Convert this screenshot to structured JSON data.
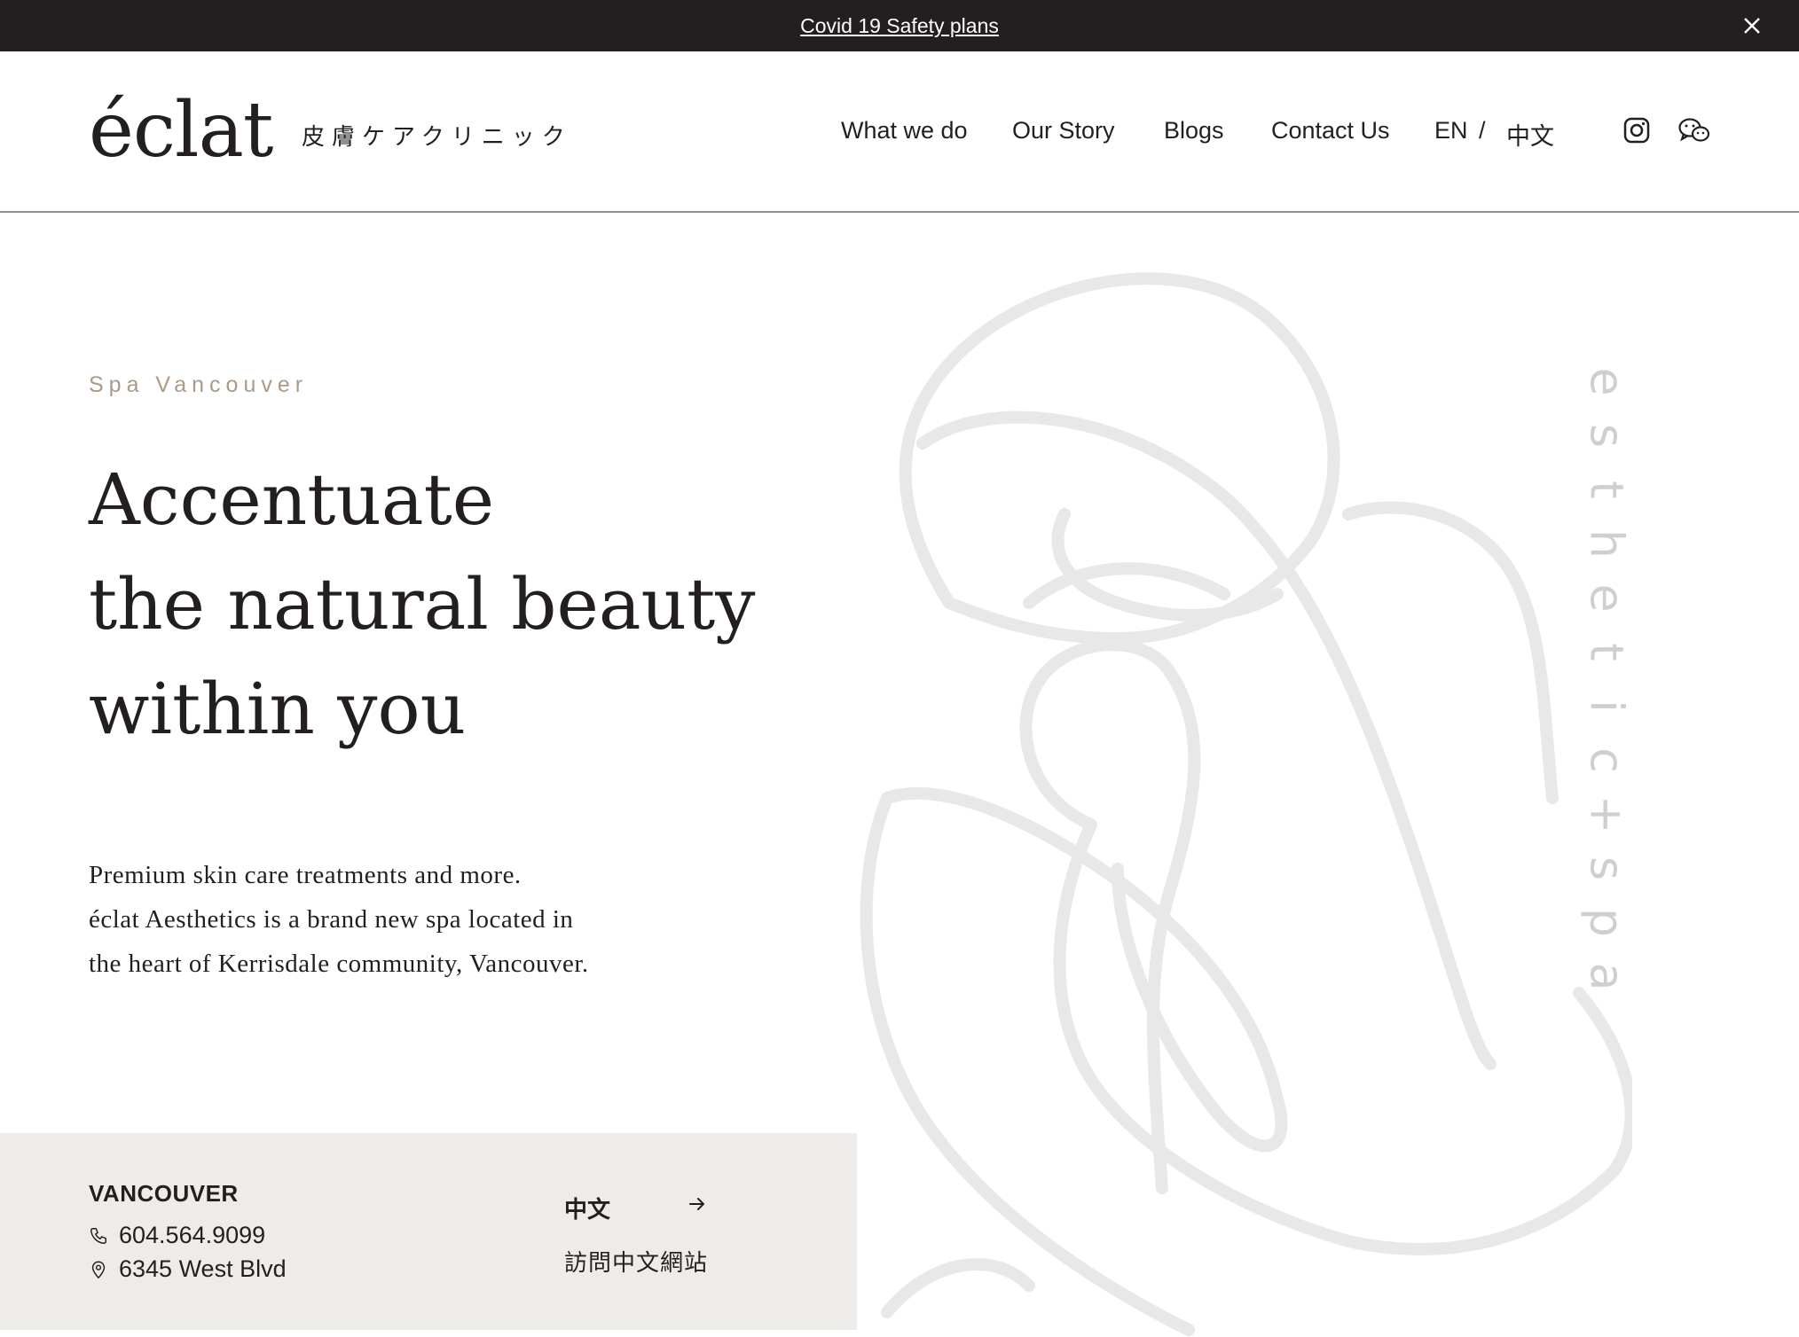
{
  "announcement": {
    "link_label": "Covid 19 Safety plans"
  },
  "header": {
    "logo": "éclat",
    "tagline_jp": "皮膚ケアクリニック",
    "nav": [
      "What we do",
      "Our Story",
      "Blogs",
      "Contact Us"
    ],
    "lang_en": "EN",
    "lang_sep": "/",
    "lang_zh": "中文"
  },
  "hero": {
    "eyebrow": "Spa Vancouver",
    "title_lines": [
      "Accentuate",
      "the natural beauty",
      "within you"
    ],
    "copy_lines": [
      "Premium skin care treatments and more.",
      "éclat Aesthetics is a brand new spa located in",
      "the heart of Kerrisdale community, Vancouver."
    ],
    "vertical_text": "esthetic+spa"
  },
  "info": {
    "city": "VANCOUVER",
    "phone": "604.564.9099",
    "address": "6345 West Blvd",
    "zh_link_title": "中文",
    "zh_link_sub": "訪問中文網站"
  },
  "icons": [
    "close-icon",
    "instagram-icon",
    "wechat-icon",
    "phone-icon",
    "location-pin-icon",
    "arrow-right-icon"
  ],
  "colors": {
    "topbar_bg": "#231f20",
    "text": "#231f20",
    "eyebrow": "#ab9a87",
    "info_bg": "#edece8",
    "art_stroke": "#e8e8e8",
    "vertical_text": "#cfcfcf"
  }
}
